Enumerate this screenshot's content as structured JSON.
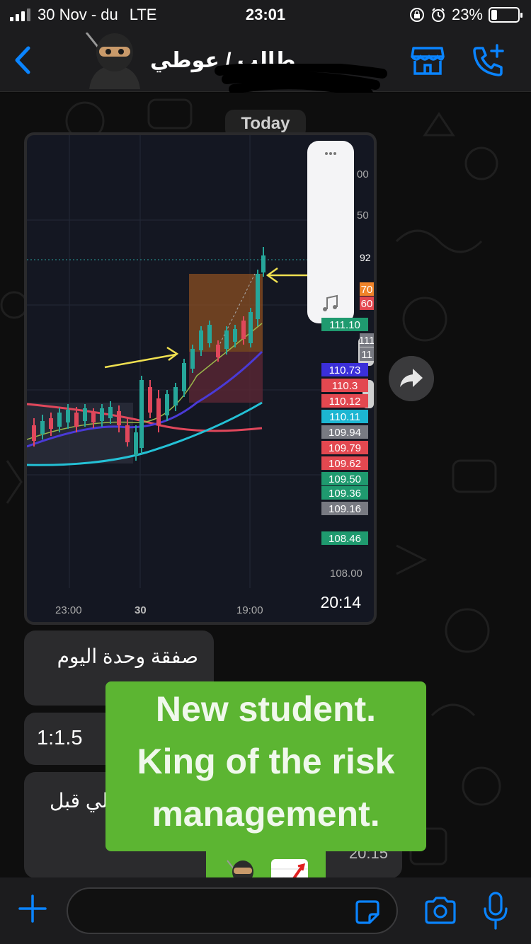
{
  "status_bar": {
    "time_carrier": "30 Nov - du",
    "network": "LTE",
    "clock": "23:01",
    "battery": "23%"
  },
  "header": {
    "contact_name": "طالب / عوطي"
  },
  "chat": {
    "date_separator": "Today",
    "image_message": {
      "time": "20:14",
      "chart": {
        "x_ticks": [
          "23:00",
          "30",
          "19:00"
        ],
        "y_top_partial": [
          "00",
          "50",
          "92"
        ],
        "price_labels": [
          {
            "value": "70",
            "color": "#f0842a"
          },
          {
            "value": "60",
            "color": "#e34850"
          },
          {
            "value": "111.10",
            "color": "#1f9a6f"
          },
          {
            "value": "111",
            "color": "#787a82"
          },
          {
            "value": "11",
            "color": "#787a82"
          },
          {
            "value": "110.73",
            "color": "#3b2fd9"
          },
          {
            "value": "110.3",
            "color": "#e34850"
          },
          {
            "value": "110.12",
            "color": "#e34850"
          },
          {
            "value": "110.11",
            "color": "#1cb6d2"
          },
          {
            "value": "109.94",
            "color": "#787a82"
          },
          {
            "value": "109.79",
            "color": "#e34850"
          },
          {
            "value": "109.62",
            "color": "#e34850"
          },
          {
            "value": "109.50",
            "color": "#1f9a6f"
          },
          {
            "value": "109.36",
            "color": "#1f9a6f"
          },
          {
            "value": "109.16",
            "color": "#787a82"
          },
          {
            "value": "108.46",
            "color": "#1f9a6f"
          }
        ],
        "axis_bottom_value": "108.00"
      }
    },
    "messages": [
      {
        "text": "صفقة وحدة اليوم"
      },
      {
        "text": "1:1.5"
      },
      {
        "text": "لي قبل",
        "time": "20:15"
      }
    ],
    "sticker": {
      "lines": [
        "New student.",
        "King of the risk",
        "management."
      ],
      "emoji": [
        "ninja",
        "chart-increasing"
      ]
    }
  },
  "colors": {
    "accent_blue": "#0a84ff",
    "sticker_green": "#5cb532",
    "bubble": "#2b2b2d"
  }
}
